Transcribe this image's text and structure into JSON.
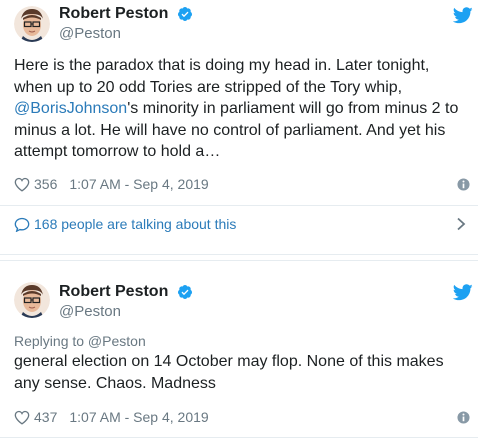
{
  "colors": {
    "link": "#2b7bb9",
    "verified": "#1da1f2",
    "muted": "#697882",
    "text": "#1c2022"
  },
  "tweets": [
    {
      "author": {
        "name": "Robert Peston",
        "handle": "@Peston",
        "verified_icon": "verified-badge-icon"
      },
      "text_before": "Here is the paradox that is doing my head in. Later tonight, when up to 20 odd Tories are stripped of the Tory whip, ",
      "mention": "@BorisJohnson",
      "text_after": "'s minority in parliament will go from minus 2 to minus a lot. He will have no control of parliament. And yet his attempt tomorrow to hold a…",
      "likes": "356",
      "timestamp": "1:07 AM - Sep 4, 2019",
      "talking": "168 people are talking about this"
    },
    {
      "author": {
        "name": "Robert Peston",
        "handle": "@Peston",
        "verified_icon": "verified-badge-icon"
      },
      "replying_to": "Replying to @Peston",
      "text": "general election on 14 October may flop. None of this makes any sense. Chaos. Madness",
      "likes": "437",
      "timestamp": "1:07 AM - Sep 4, 2019"
    }
  ]
}
